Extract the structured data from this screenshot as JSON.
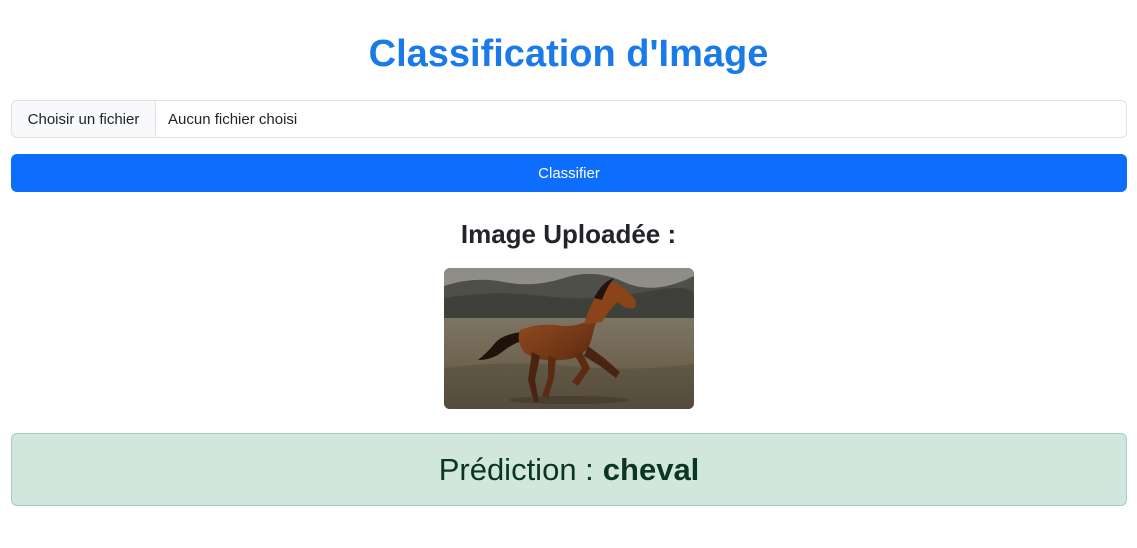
{
  "page": {
    "title": "Classification d'Image"
  },
  "upload": {
    "choose_button_label": "Choisir un fichier",
    "file_status": "Aucun fichier choisi"
  },
  "actions": {
    "classify_label": "Classifier"
  },
  "result": {
    "uploaded_heading": "Image Uploadée :",
    "prediction_label": "Prédiction :",
    "prediction_value": "cheval"
  },
  "colors": {
    "accent": "#1a7ae8",
    "primary_button": "#0d6efd",
    "success_bg": "#d1e7dd",
    "success_text": "#0a3622"
  }
}
